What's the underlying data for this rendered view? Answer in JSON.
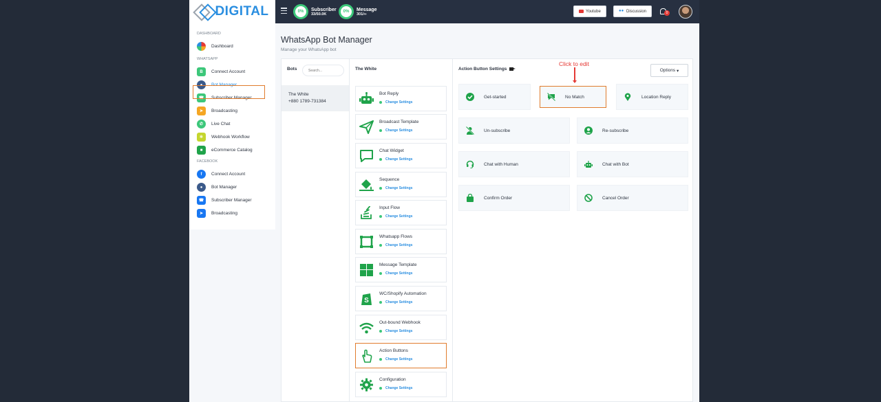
{
  "brand": {
    "logo_text": "DIGITAL"
  },
  "topbar": {
    "subscriber": {
      "percent": "0%",
      "label": "Subscriber",
      "value": "33/50.0K"
    },
    "message": {
      "percent": "0%",
      "label": "Message",
      "value": "301/∞"
    },
    "youtube_label": "Youtube",
    "discussion_label": "Discussion",
    "notification_count": "0"
  },
  "sidebar": {
    "sec_dashboard": "DASHBOARD",
    "dashboard": "Dashboard",
    "sec_whatsapp": "WHATSAPP",
    "wa_items": [
      "Connect Account",
      "Bot Manager",
      "Subscriber Manager",
      "Broadcasting",
      "Live Chat",
      "Webhook Workflow",
      "eCommerce Catalog"
    ],
    "sec_facebook": "FACEBOOK",
    "fb_items": [
      "Connect Account",
      "Bot Manager",
      "Subscriber Manager",
      "Broadcasting"
    ]
  },
  "page": {
    "title": "WhatsApp Bot Manager",
    "subtitle": "Manage your WhatsApp bot"
  },
  "bots": {
    "header": "Bots",
    "search_placeholder": "Search...",
    "items": [
      {
        "name": "The White",
        "phone": "+880 1789-731384"
      }
    ]
  },
  "settings": {
    "header": "The White",
    "change_label": "Change Settings",
    "items": [
      "Bot Reply",
      "Broadcast Template",
      "Chat Widget",
      "Sequence",
      "Input Flow",
      "Whatsapp Flows",
      "Message Template",
      "WC/Shopify Automation",
      "Out-bound Webhook",
      "Action Buttons",
      "Configuration"
    ]
  },
  "actions": {
    "header": "Action Button Settings",
    "options_label": "Options",
    "annotation": "Click to edit",
    "items": [
      "Get-started",
      "No Match",
      "Location Reply",
      "Un-subscribe",
      "Re-subscribe",
      "Chat with Human",
      "Chat with Bot",
      "Confirm Order",
      "Cancel Order"
    ]
  },
  "colors": {
    "accent": "#2a8ee0",
    "success": "#3cc77a",
    "highlight": "#e07b2c",
    "annotation": "#e53935"
  }
}
